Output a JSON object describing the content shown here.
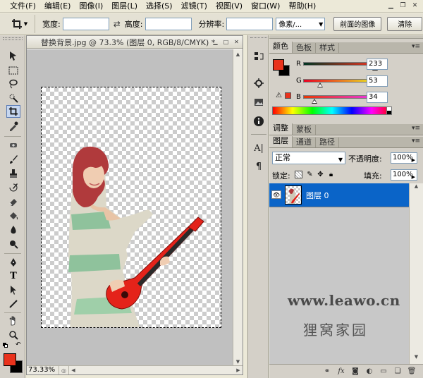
{
  "menubar": {
    "items": [
      "文件(F)",
      "编辑(E)",
      "图像(I)",
      "图层(L)",
      "选择(S)",
      "滤镜(T)",
      "视图(V)",
      "窗口(W)",
      "帮助(H)"
    ]
  },
  "options_bar": {
    "width_label": "宽度:",
    "height_label": "高度:",
    "resolution_label": "分辨率:",
    "unit_value": "像素/...",
    "front_image_button": "前面的图像",
    "clear_button": "清除"
  },
  "document": {
    "title": "替换背景.jpg @ 73.3% (图层 0, RGB/8/CMYK) *",
    "zoom": "73.33%"
  },
  "color_panel": {
    "tabs": [
      "颜色",
      "色板",
      "样式"
    ],
    "foreground": "#e9321c",
    "background": "#000000",
    "channels": [
      {
        "name": "R",
        "value": "233",
        "fraction": 0.914
      },
      {
        "name": "G",
        "value": "53",
        "fraction": 0.208
      },
      {
        "name": "B",
        "value": "34",
        "fraction": 0.133
      }
    ]
  },
  "adjust_panel": {
    "tabs": [
      "调整",
      "蒙板"
    ]
  },
  "layers_panel": {
    "tabs": [
      "图层",
      "通道",
      "路径"
    ],
    "blend_mode": "正常",
    "opacity_label": "不透明度:",
    "opacity_value": "100%",
    "lock_label": "锁定:",
    "fill_label": "填充:",
    "fill_value": "100%",
    "layers": [
      {
        "name": "图层 0",
        "visible": true,
        "selected": true
      }
    ]
  },
  "watermark": {
    "url": "www.leawo.cn",
    "name": "狸窝家园"
  },
  "colors": {
    "accent_selection": "#0a64c8",
    "foreground": "#e9321c"
  }
}
